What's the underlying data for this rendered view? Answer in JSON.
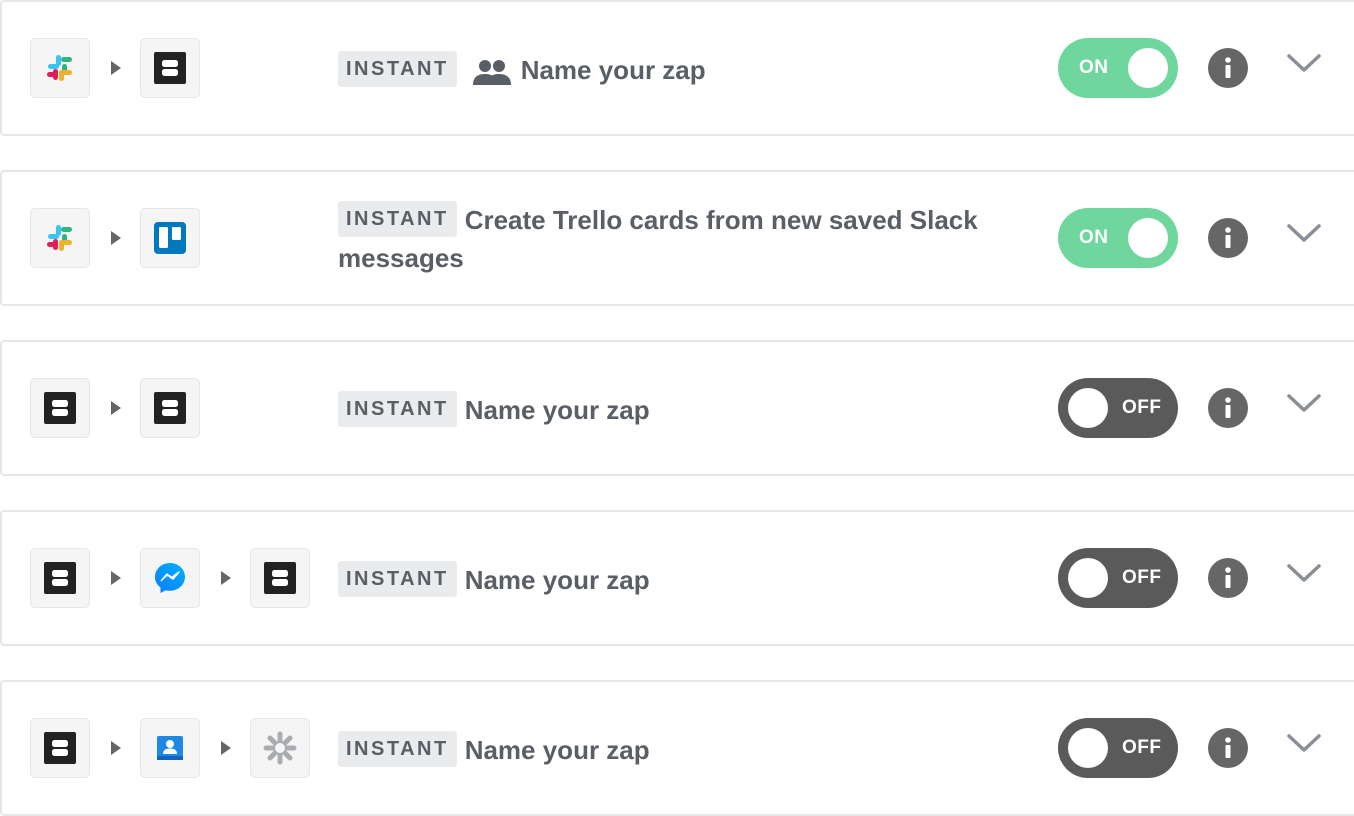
{
  "icons": {
    "arrow": "play-arrow-icon",
    "team": "people-icon",
    "info": "info-icon",
    "expand": "chevron-down-icon"
  },
  "colors": {
    "toggle_on": "#6fd79d",
    "toggle_off": "#5a5a5a",
    "badge_bg": "#e9ebed",
    "text": "#5a5f66"
  },
  "zaps": [
    {
      "apps": [
        "slack",
        "storage"
      ],
      "badge": "INSTANT",
      "shared": true,
      "title": "Name your zap",
      "status": "ON",
      "enabled": true
    },
    {
      "apps": [
        "slack",
        "trello"
      ],
      "badge": "INSTANT",
      "shared": false,
      "title": "Create Trello cards from new saved Slack messages",
      "status": "ON",
      "enabled": true
    },
    {
      "apps": [
        "storage",
        "storage"
      ],
      "badge": "INSTANT",
      "shared": false,
      "title": "Name your zap",
      "status": "OFF",
      "enabled": false
    },
    {
      "apps": [
        "storage",
        "messenger",
        "storage"
      ],
      "badge": "INSTANT",
      "shared": false,
      "title": "Name your zap",
      "status": "OFF",
      "enabled": false
    },
    {
      "apps": [
        "storage",
        "contacts",
        "settings"
      ],
      "badge": "INSTANT",
      "shared": false,
      "title": "Name your zap",
      "status": "OFF",
      "enabled": false
    }
  ]
}
